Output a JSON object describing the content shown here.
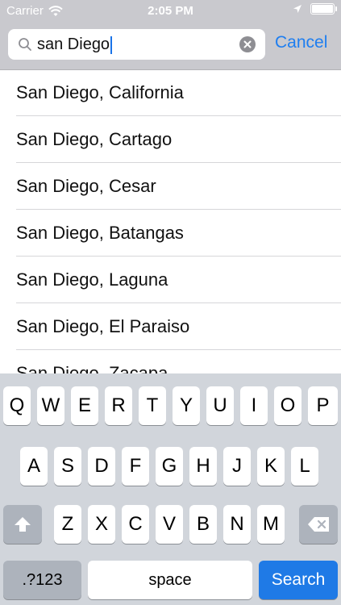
{
  "status_bar": {
    "carrier": "Carrier",
    "time": "2:05 PM"
  },
  "search": {
    "query": "san Diego",
    "cancel_label": "Cancel"
  },
  "results": [
    "San Diego, California",
    "San Diego, Cartago",
    "San Diego, Cesar",
    "San Diego, Batangas",
    "San Diego, Laguna",
    "San Diego, El Paraiso",
    "San Diego, Zacapa"
  ],
  "keyboard": {
    "row1": [
      "Q",
      "W",
      "E",
      "R",
      "T",
      "Y",
      "U",
      "I",
      "O",
      "P"
    ],
    "row2": [
      "A",
      "S",
      "D",
      "F",
      "G",
      "H",
      "J",
      "K",
      "L"
    ],
    "row3": [
      "Z",
      "X",
      "C",
      "V",
      "B",
      "N",
      "M"
    ],
    "numbers_label": ".?123",
    "space_label": "space",
    "search_label": "Search"
  },
  "colors": {
    "accent": "#1e7ef0",
    "search_key": "#1f7ae6",
    "header_bg": "#c9c9ce",
    "keyboard_bg": "#d1d5db"
  }
}
